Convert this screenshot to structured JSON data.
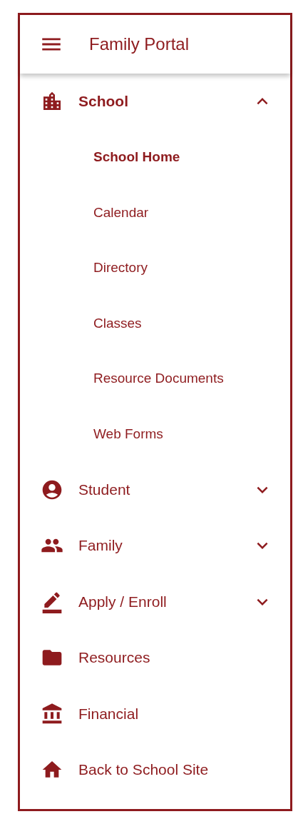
{
  "header": {
    "title": "Family Portal"
  },
  "nav": [
    {
      "kind": "group",
      "label": "School",
      "expanded": true,
      "children": [
        {
          "label": "School Home",
          "selected": true
        },
        {
          "label": "Calendar",
          "selected": false
        },
        {
          "label": "Directory",
          "selected": false
        },
        {
          "label": "Classes",
          "selected": false
        },
        {
          "label": "Resource Documents",
          "selected": false
        },
        {
          "label": "Web Forms",
          "selected": false
        }
      ]
    },
    {
      "kind": "group",
      "label": "Student",
      "expanded": false
    },
    {
      "kind": "group",
      "label": "Family",
      "expanded": false
    },
    {
      "kind": "group",
      "label": "Apply / Enroll",
      "expanded": false
    },
    {
      "kind": "link",
      "label": "Resources"
    },
    {
      "kind": "link",
      "label": "Financial"
    },
    {
      "kind": "link",
      "label": "Back to School Site"
    }
  ]
}
